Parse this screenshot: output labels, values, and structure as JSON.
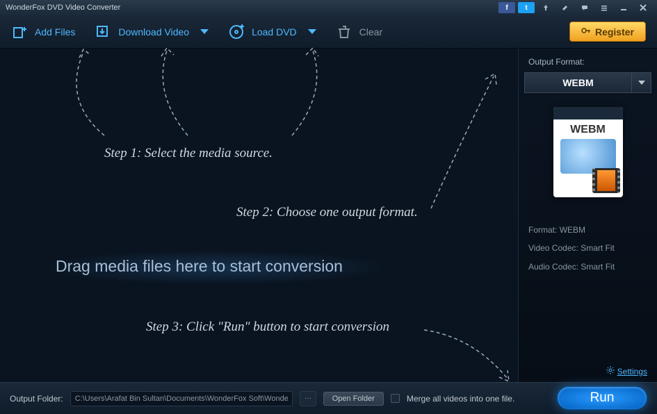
{
  "window": {
    "title": "WonderFox DVD Video Converter"
  },
  "toolbar": {
    "add_files": "Add Files",
    "download_video": "Download Video",
    "load_dvd": "Load DVD",
    "clear": "Clear",
    "register": "Register"
  },
  "hints": {
    "step1": "Step 1: Select the media source.",
    "step2": "Step 2: Choose one output format.",
    "step3": "Step 3: Click \"Run\" button to start conversion",
    "drag": "Drag media files here to start conversion"
  },
  "sidebar": {
    "output_format_label": "Output Format:",
    "selected_format": "WEBM",
    "thumb_label": "WEBM",
    "info": {
      "format_label": "Format:",
      "format_value": "WEBM",
      "video_codec_label": "Video Codec:",
      "video_codec_value": "Smart Fit",
      "audio_codec_label": "Audio Codec:",
      "audio_codec_value": "Smart Fit"
    },
    "settings": "Settings"
  },
  "bottom": {
    "output_folder_label": "Output Folder:",
    "output_folder_path": "C:\\Users\\Arafat Bin Sultan\\Documents\\WonderFox Soft\\WonderFox DVD",
    "browse": "···",
    "open_folder": "Open Folder",
    "merge_label": "Merge all videos into one file.",
    "run": "Run"
  },
  "colors": {
    "accent": "#4fb8ff",
    "run": "#2a9aff",
    "register": "#f0a020"
  }
}
